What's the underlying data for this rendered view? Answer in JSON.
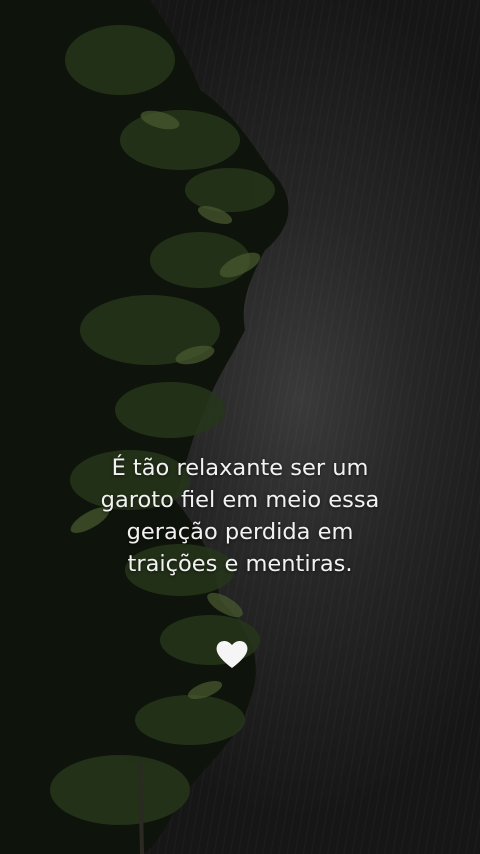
{
  "caption": {
    "lines": [
      "É tão relaxante ser um",
      "garoto fiel em meio essa",
      "geração perdida em",
      "traições e mentiras."
    ]
  },
  "emoji": {
    "icon": "white-heart-icon",
    "color": "#f5f5f5"
  },
  "scene": {
    "description_colors": {
      "sky": "#262626",
      "leaves": "#1f2a15"
    }
  }
}
